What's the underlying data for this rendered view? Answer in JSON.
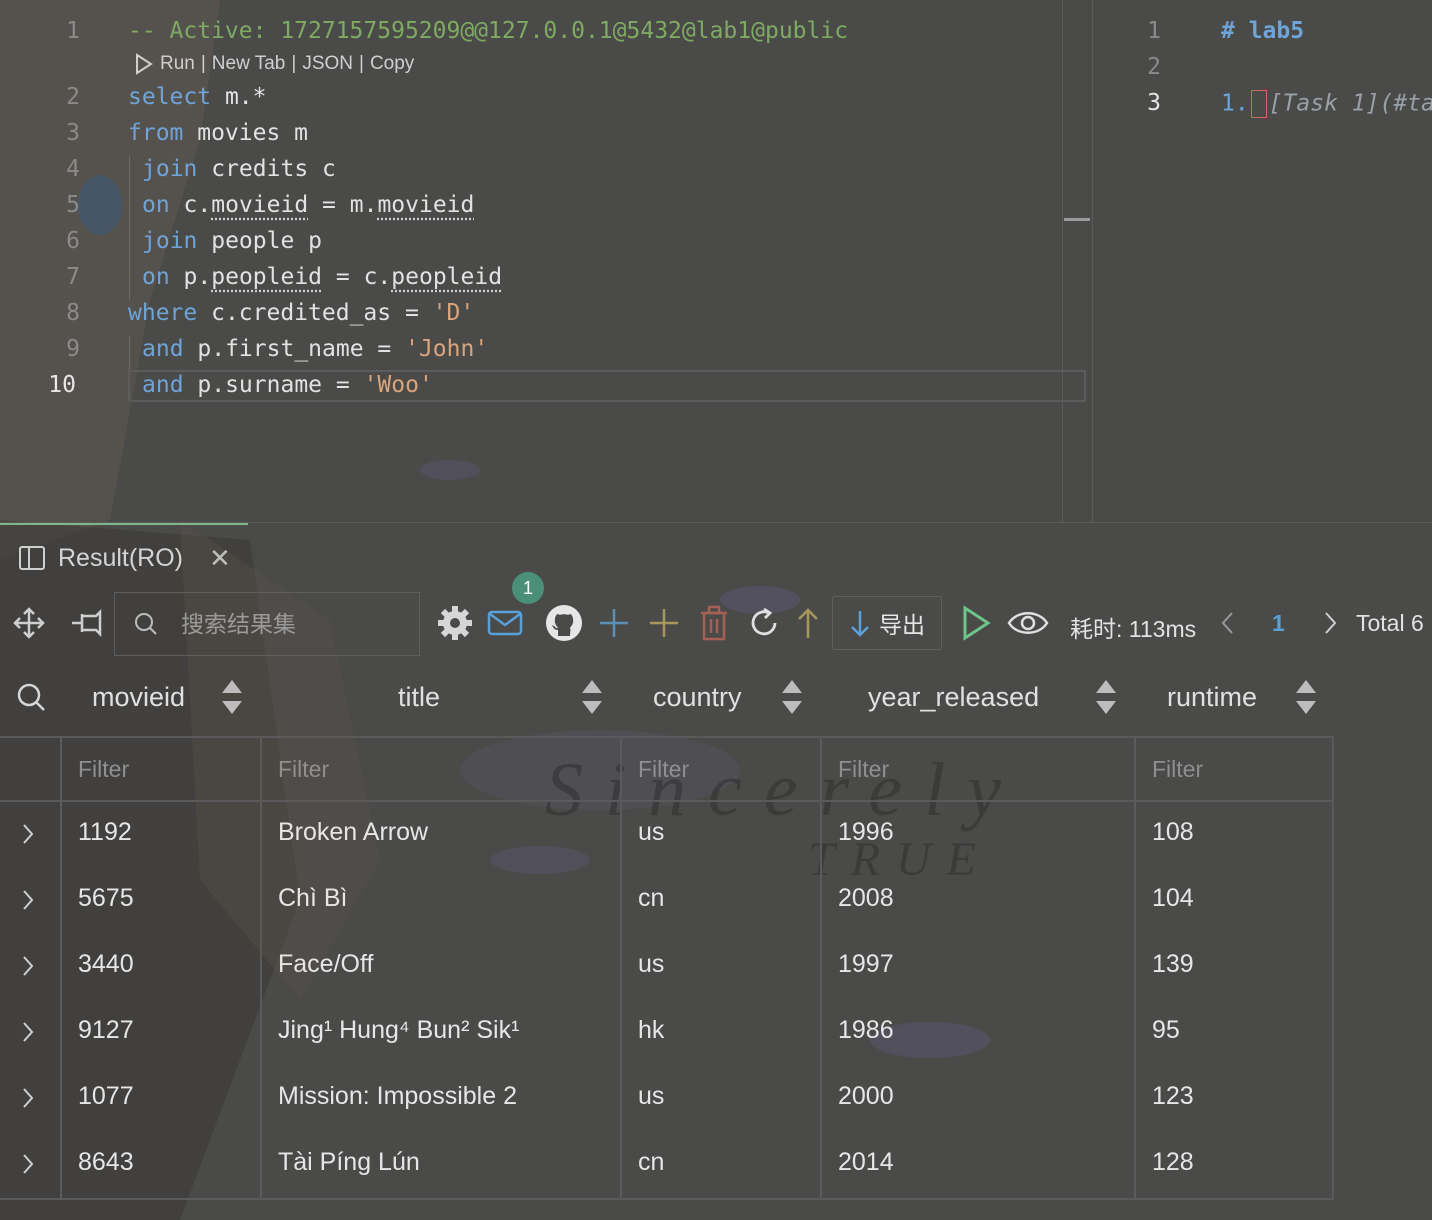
{
  "editor": {
    "line_numbers": [
      "1",
      "2",
      "3",
      "4",
      "5",
      "6",
      "7",
      "8",
      "9",
      "10"
    ],
    "comment_line": "-- Active: 1727157595209@@127.0.0.1@5432@lab1@public",
    "codelens": {
      "run": "Run",
      "new_tab": "New Tab",
      "json": "JSON",
      "copy": "Copy",
      "sep": "|"
    },
    "lines": {
      "l2_kw": "select",
      "l2_rest": " m.*",
      "l3_kw": "from",
      "l3_rest": " movies m",
      "l4_kw": "join",
      "l4_rest": " credits c",
      "l5_kw": "on",
      "l5_a": " c.",
      "l5_b": "movieid",
      "l5_c": " = m.",
      "l5_d": "movieid",
      "l6_kw": "join",
      "l6_rest": " people p",
      "l7_kw": "on",
      "l7_a": " p.",
      "l7_b": "peopleid",
      "l7_c": " = c.",
      "l7_d": "peopleid",
      "l8_kw": "where",
      "l8_rest": " c.credited_as = ",
      "l8_str": "'D'",
      "l9_kw": "and",
      "l9_rest": " p.first_name = ",
      "l9_str": "'John'",
      "l10_kw": "and",
      "l10_rest": " p.surname = ",
      "l10_str": "'Woo'"
    }
  },
  "markdown": {
    "line_numbers": [
      "1",
      "2",
      "3"
    ],
    "heading": "# lab5",
    "item_num": "1.",
    "item_text": "[Task 1](#ta"
  },
  "panel": {
    "tab_label": "Result(RO)",
    "search_placeholder": "搜索结果集",
    "mail_badge": "1",
    "export_label": "导出",
    "elapsed": "耗时: 113ms",
    "page": "1",
    "total": "Total 6"
  },
  "table": {
    "columns": [
      "movieid",
      "title",
      "country",
      "year_released",
      "runtime"
    ],
    "filter_placeholder": "Filter",
    "rows": [
      [
        "1192",
        "Broken Arrow",
        "us",
        "1996",
        "108"
      ],
      [
        "5675",
        "Chì Bì",
        "cn",
        "2008",
        "104"
      ],
      [
        "3440",
        "Face/Off",
        "us",
        "1997",
        "139"
      ],
      [
        "9127",
        "Jing¹ Hung⁴ Bun² Sik¹",
        "hk",
        "1986",
        "95"
      ],
      [
        "1077",
        "Mission: Impossible 2",
        "us",
        "2000",
        "123"
      ],
      [
        "8643",
        "Tài Píng Lún",
        "cn",
        "2014",
        "128"
      ]
    ]
  },
  "colors": {
    "accent_green": "#7fb58a",
    "keyword": "#6ea4d8",
    "string": "#d9a57c",
    "comment": "#7faa62"
  }
}
